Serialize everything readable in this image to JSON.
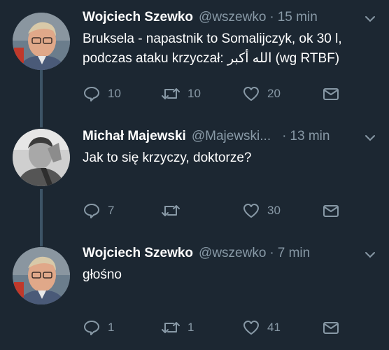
{
  "tweets": [
    {
      "name": "Wojciech Szewko",
      "handle": "@wszewko",
      "separator": "·",
      "time": "15 min",
      "text": "Bruksela - napastnik to Somalijczyk, ok 30 l, podczas ataku krzyczał: الله أكبر (wg RTBF)",
      "replies": "10",
      "retweets": "10",
      "likes": "20",
      "avatar": "man-with-glasses-avatar"
    },
    {
      "name": "Michał Majewski",
      "handle": "@Majewski...",
      "separator": "·",
      "time": "13 min",
      "text": "Jak to się krzyczy, doktorze?",
      "replies": "7",
      "retweets": "",
      "likes": "30",
      "avatar": "man-black-and-white-avatar"
    },
    {
      "name": "Wojciech Szewko",
      "handle": "@wszewko",
      "separator": "·",
      "time": "7 min",
      "text": "głośno",
      "replies": "1",
      "retweets": "1",
      "likes": "41",
      "avatar": "man-with-glasses-avatar"
    }
  ],
  "colors": {
    "background": "#1c2732",
    "text": "#ffffff",
    "muted": "#8899a6",
    "thread_line": "#3d5466"
  }
}
